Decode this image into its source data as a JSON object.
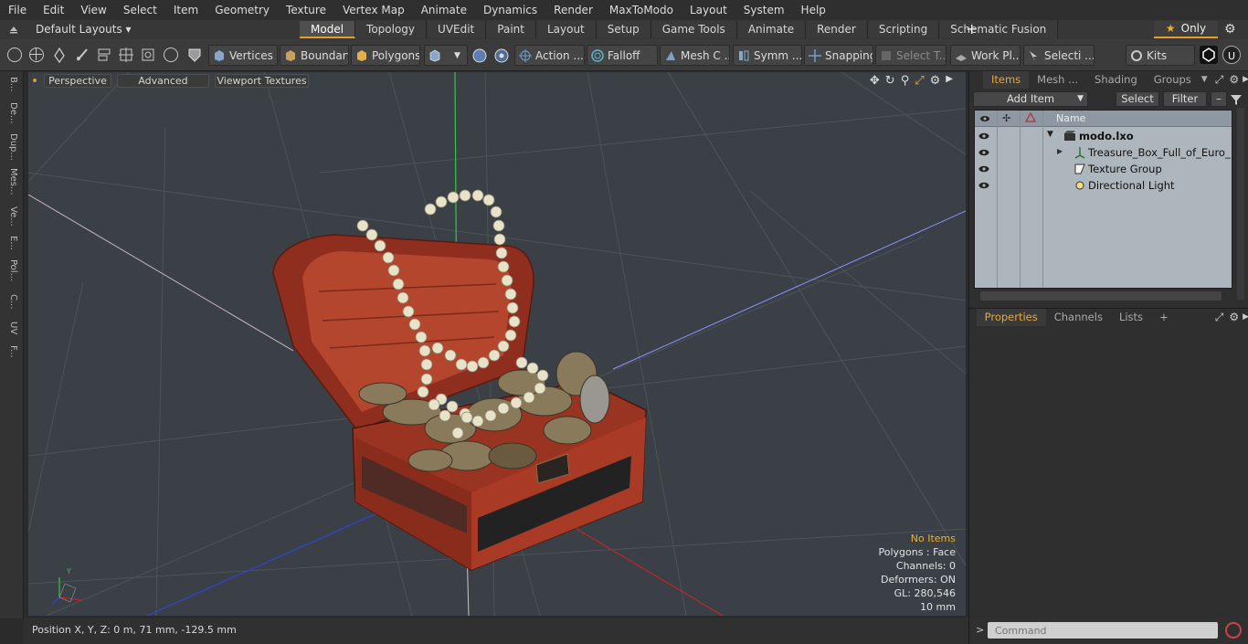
{
  "menu": [
    "File",
    "Edit",
    "View",
    "Select",
    "Item",
    "Geometry",
    "Texture",
    "Vertex Map",
    "Animate",
    "Dynamics",
    "Render",
    "MaxToModo",
    "Layout",
    "System",
    "Help"
  ],
  "layout": {
    "selector": "Default Layouts ▾",
    "tabs": [
      "Model",
      "Topology",
      "UVEdit",
      "Paint",
      "Layout",
      "Setup",
      "Game Tools",
      "Animate",
      "Render",
      "Scripting",
      "Schematic Fusion"
    ],
    "active_tab": "Model",
    "plus": "+",
    "only": "Only"
  },
  "toolbar": {
    "vertices": "Vertices",
    "boundary": "Boundary",
    "polygons": "Polygons",
    "action": "Action ...",
    "falloff": "Falloff",
    "mesh_c": "Mesh C ...",
    "symm": "Symm ...",
    "snapping": "Snapping",
    "select_t": "Select T...",
    "work_pl": "Work Pl...",
    "selecti": "Selecti ...",
    "kits": "Kits"
  },
  "left_tabs": [
    "B...",
    "De...",
    "Dup...",
    "Mes...",
    "Ve...",
    "E...",
    "Pol...",
    "C...",
    "UV",
    "F..."
  ],
  "viewport": {
    "perspective": "Perspective",
    "advanced": "Advanced",
    "viewport_textures": "Viewport Textures",
    "info": {
      "no_items": "No Items",
      "polygons": "Polygons : Face",
      "channels": "Channels: 0",
      "deformers": "Deformers: ON",
      "gl": "GL: 280,546",
      "scale": "10 mm"
    },
    "axis_y": "Y"
  },
  "status": {
    "position": "Position X, Y, Z:   0 m, 71 mm, -129.5 mm"
  },
  "items_panel": {
    "tabs": [
      "Items",
      "Mesh ...",
      "Shading",
      "Groups"
    ],
    "active_tab": "Items",
    "add_item": "Add Item",
    "select": "Select",
    "filter": "Filter",
    "column_name": "Name",
    "rows": [
      {
        "label": "modo.lxo"
      },
      {
        "label": "Treasure_Box_Full_of_Euro_ ..."
      },
      {
        "label": "Texture Group"
      },
      {
        "label": "Directional Light"
      }
    ]
  },
  "properties_panel": {
    "tabs": [
      "Properties",
      "Channels",
      "Lists"
    ],
    "active_tab": "Properties",
    "plus": "+"
  },
  "command": {
    "prompt": ">",
    "placeholder": "Command"
  },
  "colors": {
    "accent": "#e8a83a",
    "viewport_bg": "#3a4046",
    "tree_bg": "#aeb6bd",
    "chest_red": "#a83a26"
  }
}
